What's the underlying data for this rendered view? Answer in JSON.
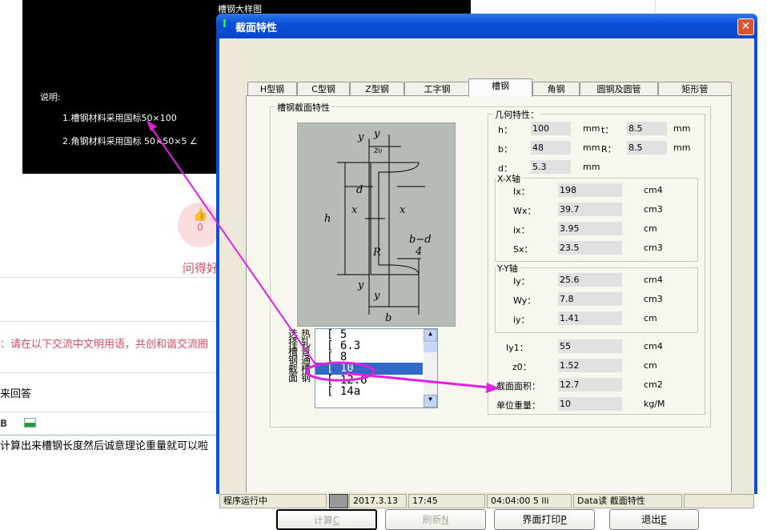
{
  "background_page": {
    "cad": {
      "title": "槽钢大样图",
      "note_heading": "说明:",
      "note1": "1.槽钢材料采用国标50×100",
      "note2": "2.角钢材料采用国标  50×50×5 ∠"
    },
    "like_count": "0",
    "good_question": "问得好",
    "notice": "：请在以下交流中文明用语，共创和谐交流圈",
    "answer_prompt": "来回答",
    "toolbar_bold": "B",
    "answer_text": "计算出来槽钢长度然后诚意理论重量就可以啦"
  },
  "dialog": {
    "title": "截面特性",
    "tabs": [
      {
        "label": "H型钢"
      },
      {
        "label": "C型钢"
      },
      {
        "label": "Z型钢"
      },
      {
        "label": "工字钢"
      },
      {
        "label": "槽钢",
        "active": true
      },
      {
        "label": "角钢"
      },
      {
        "label": "圆钢及圆管"
      },
      {
        "label": "矩形管"
      }
    ],
    "section_group": "槽钢截面特性",
    "list_label_left": "选择槽钢截面",
    "list_label_right": "热轧普通槽钢",
    "list_items": [
      "[ 5",
      "[ 6.3",
      "[ 8",
      "[ 10",
      "[ 12.6",
      "[ 14a"
    ],
    "selected_item": "[ 10",
    "geometry": {
      "title": "几何特性：",
      "h": {
        "label": "h：",
        "value": "100",
        "unit": "mm"
      },
      "t": {
        "label": "t：",
        "value": "8.5",
        "unit": "mm"
      },
      "b": {
        "label": "b：",
        "value": "48",
        "unit": "mm"
      },
      "R": {
        "label": "R：",
        "value": "8.5",
        "unit": "mm"
      },
      "d": {
        "label": "d：",
        "value": "5.3",
        "unit": "mm"
      }
    },
    "xx": {
      "title": "X-X轴",
      "rows": [
        {
          "label": "Ix：",
          "value": "198",
          "unit": "cm4"
        },
        {
          "label": "Wx：",
          "value": "39.7",
          "unit": "cm3"
        },
        {
          "label": "ix：",
          "value": "3.95",
          "unit": "cm"
        },
        {
          "label": "Sx：",
          "value": "23.5",
          "unit": "cm3"
        }
      ]
    },
    "yy": {
      "title": "Y-Y轴",
      "rows": [
        {
          "label": "Iy：",
          "value": "25.6",
          "unit": "cm4"
        },
        {
          "label": "Wy：",
          "value": "7.8",
          "unit": "cm3"
        },
        {
          "label": "iy：",
          "value": "1.41",
          "unit": "cm"
        }
      ]
    },
    "other": [
      {
        "label": "Iy1：",
        "value": "55",
        "unit": "cm4"
      },
      {
        "label": "z0：",
        "value": "1.52",
        "unit": "cm"
      },
      {
        "label": "截面面积：",
        "value": "12.7",
        "unit": "cm2"
      },
      {
        "label": "单位重量：",
        "value": "10",
        "unit": "kg/M"
      }
    ],
    "buttons": {
      "calc": "计算",
      "calc_key": "C",
      "refresh": "刷新",
      "refresh_key": "N",
      "print": "界面打印",
      "print_key": "P",
      "exit": "退出",
      "exit_key": "E"
    },
    "status": [
      "程序运行中",
      "2017.3.13",
      "17:45",
      "04:04:00 5 lli",
      "Data读 截面特性"
    ]
  },
  "colors": {
    "annotation": "#e020e0",
    "titlebar": "#0a4fd8",
    "selection": "#316ac5",
    "close": "#d9532c"
  }
}
